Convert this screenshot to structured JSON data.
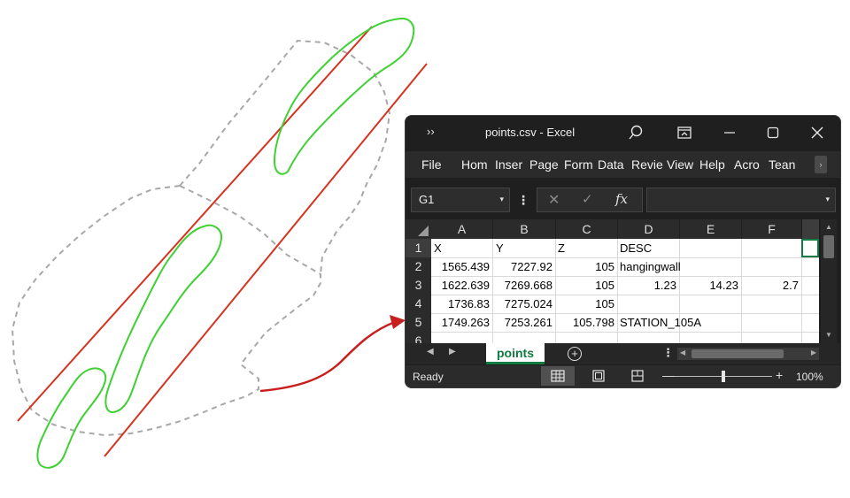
{
  "window": {
    "title": "points.csv  -  Excel",
    "overflow_chevron": "››",
    "buttons": [
      "search-icon",
      "ribbon-display-icon",
      "minimize-icon",
      "maximize-icon",
      "close-icon"
    ]
  },
  "ribbon": {
    "tabs": [
      "File",
      "Hom",
      "Inser",
      "Page",
      "Form",
      "Data",
      "Revie",
      "View",
      "Help",
      "Acro",
      "Tean"
    ],
    "scroll_glyph": "›"
  },
  "formula_bar": {
    "name_box": "G1",
    "dropdown_glyph": "▾",
    "more_glyph": "⋮",
    "cancel_glyph": "✕",
    "enter_glyph": "✓",
    "fx_label": "fx",
    "value": ""
  },
  "sheet": {
    "columns": [
      "A",
      "B",
      "C",
      "D",
      "E",
      "F"
    ],
    "rows": [
      "1",
      "2",
      "3",
      "4",
      "5",
      "6"
    ],
    "selected_cell": "G1",
    "cells": [
      [
        "X",
        "Y",
        "Z",
        "DESC",
        "",
        ""
      ],
      [
        "1565.439",
        "7227.92",
        "105",
        "hangingwall",
        "",
        ""
      ],
      [
        "1622.639",
        "7269.668",
        "105",
        "1.23",
        "14.23",
        "2.7"
      ],
      [
        "1736.83",
        "7275.024",
        "105",
        "",
        "",
        ""
      ],
      [
        "1749.263",
        "7253.261",
        "105.798",
        "STATION_105A",
        "",
        ""
      ]
    ]
  },
  "tabs": {
    "nav_prev": "◀",
    "nav_next": "▶",
    "sheet_name": "points",
    "add_sheet": "+",
    "more_glyph": "⋮"
  },
  "status": {
    "ready": "Ready",
    "zoom_minus": "—",
    "zoom_plus": "+",
    "zoom": "100%"
  },
  "colors": {
    "excel_green": "#107c41",
    "boundary": "#a8a8a8",
    "faults": "#d6321f",
    "vein": "#3fd134",
    "arrow": "#c81e1e"
  }
}
